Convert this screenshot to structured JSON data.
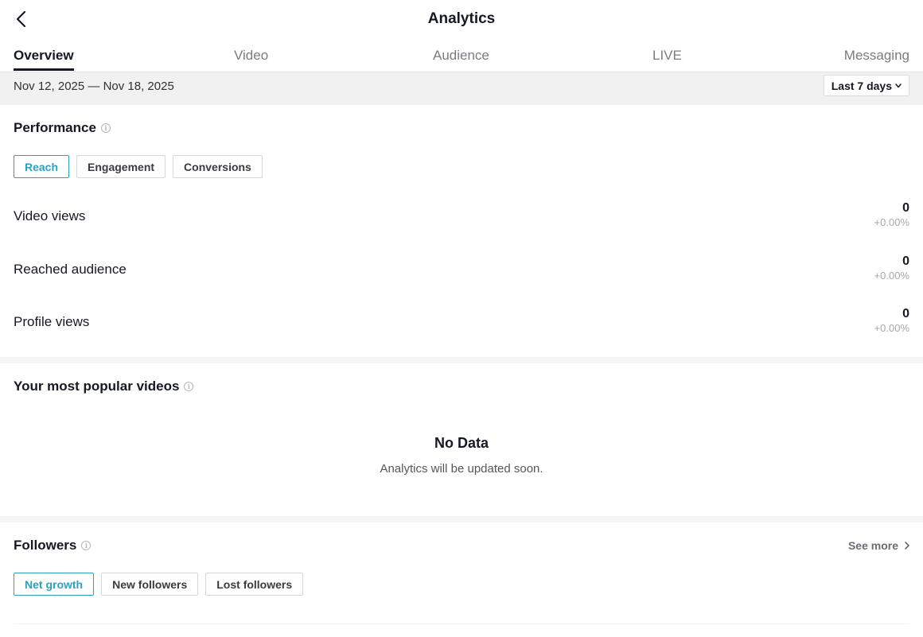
{
  "header": {
    "title": "Analytics",
    "back_icon": "chevron-left-icon"
  },
  "tabs": [
    {
      "label": "Overview",
      "active": true
    },
    {
      "label": "Video",
      "active": false
    },
    {
      "label": "Audience",
      "active": false
    },
    {
      "label": "LIVE",
      "active": false
    },
    {
      "label": "Messaging",
      "active": false
    }
  ],
  "date_bar": {
    "range": "Nov 12, 2025 — Nov 18, 2025",
    "select_label": "Last 7 days",
    "select_icon": "chevron-down-icon"
  },
  "performance": {
    "title": "Performance",
    "chips": [
      {
        "label": "Reach",
        "active": true
      },
      {
        "label": "Engagement",
        "active": false
      },
      {
        "label": "Conversions",
        "active": false
      }
    ],
    "metrics": [
      {
        "label": "Video views",
        "value": "0",
        "change": "+0.00%"
      },
      {
        "label": "Reached audience",
        "value": "0",
        "change": "+0.00%"
      },
      {
        "label": "Profile views",
        "value": "0",
        "change": "+0.00%"
      }
    ]
  },
  "popular_videos": {
    "title": "Your most popular videos",
    "empty_title": "No Data",
    "empty_subtitle": "Analytics will be updated soon."
  },
  "followers": {
    "title": "Followers",
    "see_more": "See more",
    "chips": [
      {
        "label": "Net growth",
        "active": true
      },
      {
        "label": "New followers",
        "active": false
      },
      {
        "label": "Lost followers",
        "active": false
      }
    ]
  },
  "colors": {
    "accent": "#2aa1c1",
    "text": "#161823",
    "muted": "#a6a7ab",
    "date_bar_bg": "#f1f1f2"
  }
}
